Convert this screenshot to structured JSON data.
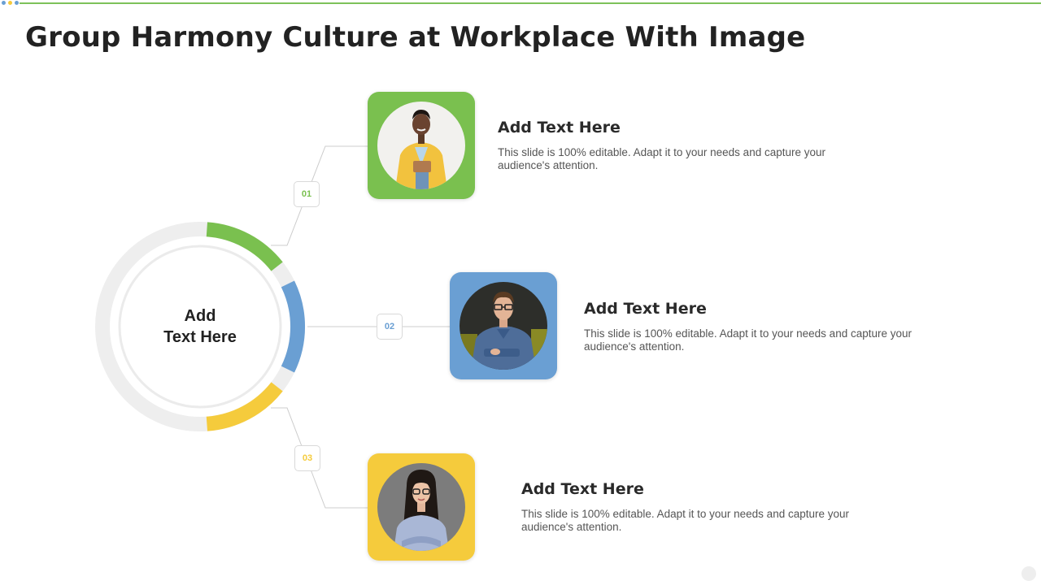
{
  "title": "Group Harmony Culture at Workplace With Image",
  "colors": {
    "green": "#7ac04f",
    "blue": "#6a9fd3",
    "yellow": "#f5cb3c",
    "ring": "#eeeeee"
  },
  "center": {
    "label_line1": "Add",
    "label_line2": "Text Here"
  },
  "items": [
    {
      "number": "01",
      "heading": "Add Text Here",
      "description": "This slide is 100% editable. Adapt it to your needs and capture your audience's attention.",
      "photo": "woman-with-tablet-photo"
    },
    {
      "number": "02",
      "heading": "Add Text Here",
      "description": "This slide is 100% editable. Adapt it to your needs and capture your audience's attention.",
      "photo": "man-with-glasses-photo"
    },
    {
      "number": "03",
      "heading": "Add Text Here",
      "description": "This slide is 100% editable. Adapt it to your needs and capture your audience's attention.",
      "photo": "woman-with-glasses-photo"
    }
  ]
}
